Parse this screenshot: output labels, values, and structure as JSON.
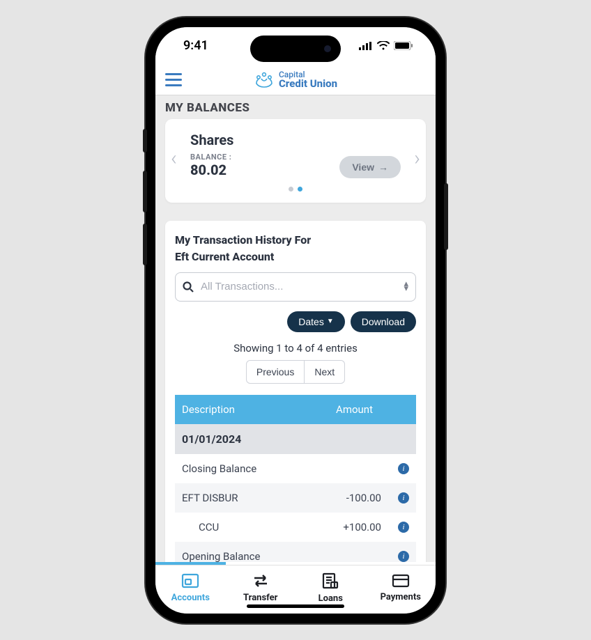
{
  "status": {
    "time": "9:41"
  },
  "brand": {
    "line1": "Capital",
    "line2": "Credit Union"
  },
  "balances": {
    "title": "MY BALANCES",
    "card": {
      "name": "Shares",
      "balance_label": "BALANCE :",
      "balance_amount": "80.02",
      "view_label": "View"
    }
  },
  "tx": {
    "title_line1": "My Transaction History For",
    "title_line2": "Eft Current Account",
    "search_placeholder": "All Transactions...",
    "dates_label": "Dates",
    "download_label": "Download",
    "entries_text": "Showing 1 to 4 of 4 entries",
    "prev_label": "Previous",
    "next_label": "Next",
    "header_desc": "Description",
    "header_amt": "Amount",
    "date_group": "01/01/2024",
    "rows": [
      {
        "desc": "Closing Balance",
        "amt": ""
      },
      {
        "desc": "EFT DISBUR",
        "amt": "-100.00"
      },
      {
        "desc": "CCU",
        "amt": "+100.00"
      },
      {
        "desc": "Opening Balance",
        "amt": ""
      }
    ]
  },
  "tabs": {
    "accounts": "Accounts",
    "transfer": "Transfer",
    "loans": "Loans",
    "payments": "Payments"
  }
}
